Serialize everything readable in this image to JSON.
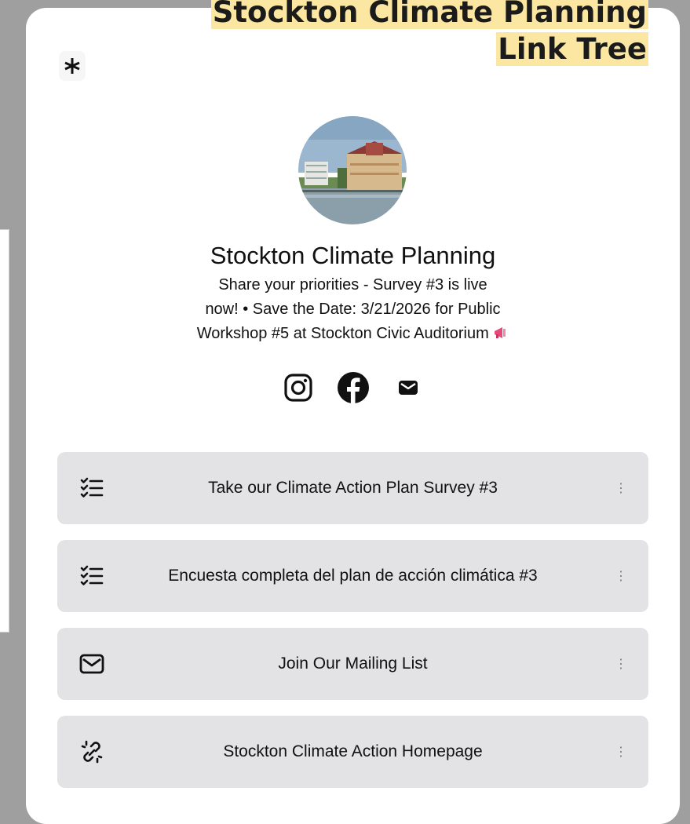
{
  "heading": {
    "line1": "Stockton Climate Planning",
    "line2": "Link Tree"
  },
  "logo": {
    "icon": "asterisk-icon"
  },
  "profile": {
    "name": "Stockton Climate Planning",
    "bio_line1": "Share your priorities - Survey #3 is live",
    "bio_line2": "now! • Save the Date: 3/21/2026 for Public",
    "bio_line3": "Workshop #5 at Stockton Civic Auditorium",
    "bio_emoji": "megaphone-icon"
  },
  "socials": [
    {
      "icon": "instagram-icon"
    },
    {
      "icon": "facebook-icon"
    },
    {
      "icon": "email-icon"
    }
  ],
  "links": [
    {
      "label": "Take our Climate Action Plan Survey #3",
      "icon": "checklist-icon"
    },
    {
      "label": "Encuesta completa del plan de acción climática #3",
      "icon": "checklist-icon"
    },
    {
      "label": "Join Our Mailing List",
      "icon": "envelope-icon"
    },
    {
      "label": "Stockton Climate Action Homepage",
      "icon": "broken-link-icon"
    }
  ],
  "colors": {
    "highlight": "#fbe7a1",
    "button_bg": "#e3e3e5",
    "backdrop": "#9f9f9f"
  }
}
